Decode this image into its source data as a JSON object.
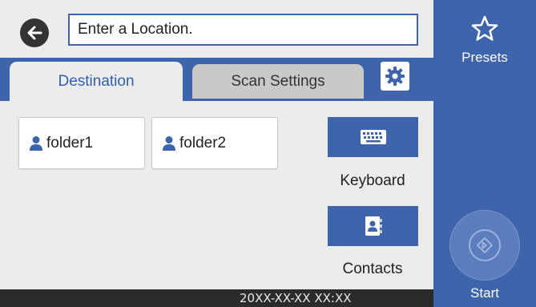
{
  "header": {
    "location_placeholder": "Enter a Location.",
    "back_icon": "back-arrow-icon"
  },
  "tabs": [
    {
      "label": "Destination",
      "active": true
    },
    {
      "label": "Scan Settings",
      "active": false
    }
  ],
  "settings_icon": "gear-icon",
  "folders": [
    {
      "label": "folder1",
      "icon": "person-icon"
    },
    {
      "label": "folder2",
      "icon": "person-icon"
    }
  ],
  "actions": {
    "keyboard_label": "Keyboard",
    "contacts_label": "Contacts"
  },
  "status_bar": {
    "datetime": "20XX-XX-XX XX:XX"
  },
  "right_panel": {
    "presets_label": "Presets",
    "start_label": "Start"
  },
  "colors": {
    "accent_blue": "#3e64ac",
    "background": "#ececec",
    "active_tab_text": "#2f5fb3",
    "status_bar": "#2b2b2b"
  }
}
